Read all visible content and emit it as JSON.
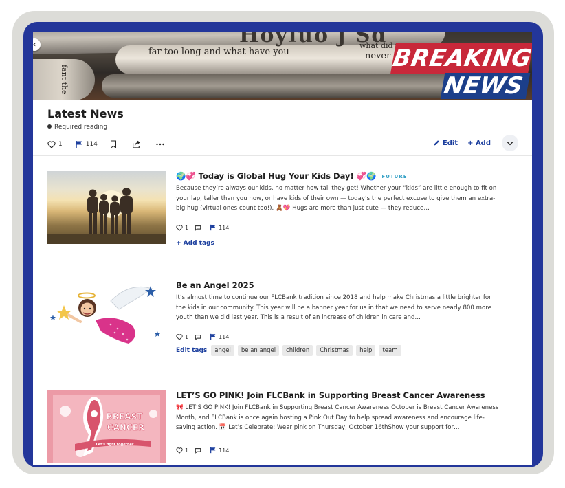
{
  "banner": {
    "paper_text_1": "far too long and what have you",
    "paper_text_2": "what did you",
    "paper_text_3": "never talk",
    "paper_text_4": "Hoyluo j Sd",
    "paper_text_5": "fant the",
    "breaking": "BREAKING",
    "news": "NEWS",
    "back_icon": "chevron-left-icon"
  },
  "header": {
    "title": "Latest News",
    "required": "Required reading",
    "like_count": "1",
    "flag_count": "114",
    "edit_label": "Edit",
    "add_label": "+ Add"
  },
  "articles": [
    {
      "emoji_prefix": "🌍💞",
      "title": "Today is Global Hug Your Kids Day!",
      "emoji_suffix": "💞🌍",
      "badge": "FUTURE",
      "body": "Because they’re always our kids, no matter how tall they get! Whether your “kids” are little enough to fit on your lap, taller than you now, or have kids of their own — today’s the perfect excuse to give them an extra-big hug (virtual ones count too!). 🧸💖 Hugs are more than just cute — they reduce…",
      "likes": "1",
      "flags": "114",
      "tag_action": "+ Add tags",
      "tags": []
    },
    {
      "title": "Be an Angel 2025",
      "body": "It’s almost time to continue our FLCBank tradition since 2018 and help make Christmas a little brighter for the kids in our community. This year will be a banner year for us in that we need to serve nearly 800 more youth than we did last year. This is a result of an increase of children in care and…",
      "likes": "1",
      "flags": "114",
      "tag_action": "Edit tags",
      "tags": [
        "angel",
        "be an angel",
        "children",
        "Christmas",
        "help",
        "team"
      ]
    },
    {
      "title": "LET’S GO PINK! Join FLCBank in Supporting Breast Cancer Awareness",
      "body": "🎀 LET’S GO PINK! Join FLCBank in Supporting Breast Cancer Awareness October is Breast Cancer Awareness Month, and FLCBank is once again hosting a Pink Out Day to help spread awareness and encourage life-saving action. 📅 Let’s Celebrate: Wear pink on Thursday, October 16thShow your support for…",
      "likes": "1",
      "flags": "114",
      "image_text_1": "BREAST",
      "image_text_2": "CANCER",
      "image_text_3": "Let's fight together"
    }
  ],
  "colors": {
    "accent": "#1c3f9e",
    "frame_blue": "#23369a",
    "breaking_red": "#c8283a",
    "news_blue": "#1c3f8a"
  }
}
